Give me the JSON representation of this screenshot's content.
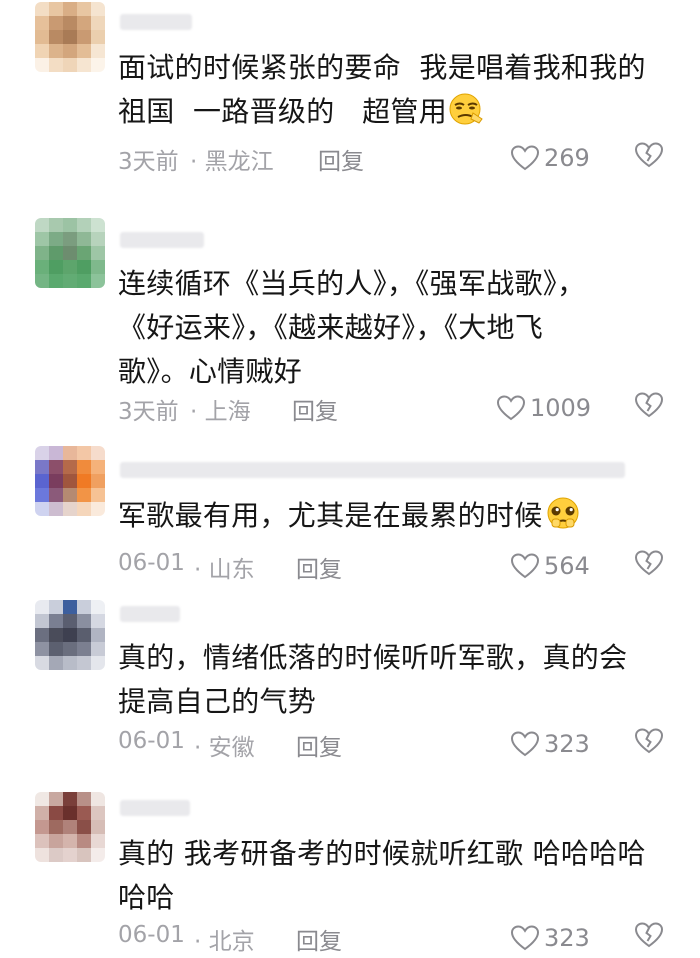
{
  "comments": [
    {
      "text": "面试的时候紧张的要命  我是唱着我和我的\n祖国  一路晋级的   超管用",
      "emoji": "smug-face-emoji",
      "time": "3天前",
      "location": "· 黑龙江",
      "reply": "回复",
      "likes": "269"
    },
    {
      "text": "连续循环《当兵的人》，《强军战歌》，\n《好运来》，《越来越好》，《大地飞\n歌》。心情贼好",
      "emoji": "",
      "time": "3天前",
      "location": "· 上海",
      "reply": "回复",
      "likes": "1009"
    },
    {
      "text": "军歌最有用，尤其是在最累的时候",
      "emoji": "pleading-face-emoji",
      "time": "06-01",
      "location": "· 山东",
      "reply": "回复",
      "likes": "564"
    },
    {
      "text": "真的，情绪低落的时候听听军歌，真的会\n提高自己的气势",
      "emoji": "",
      "time": "06-01",
      "location": "· 安徽",
      "reply": "回复",
      "likes": "323"
    },
    {
      "text": "真的 我考研备考的时候就听红歌 哈哈哈哈\n哈哈",
      "emoji": "",
      "time": "06-01",
      "location": "· 北京",
      "reply": "回复",
      "likes": "323"
    }
  ],
  "colors": {
    "text": "#161616",
    "meta": "#a3a3a8",
    "icon": "#8a8a8f"
  }
}
